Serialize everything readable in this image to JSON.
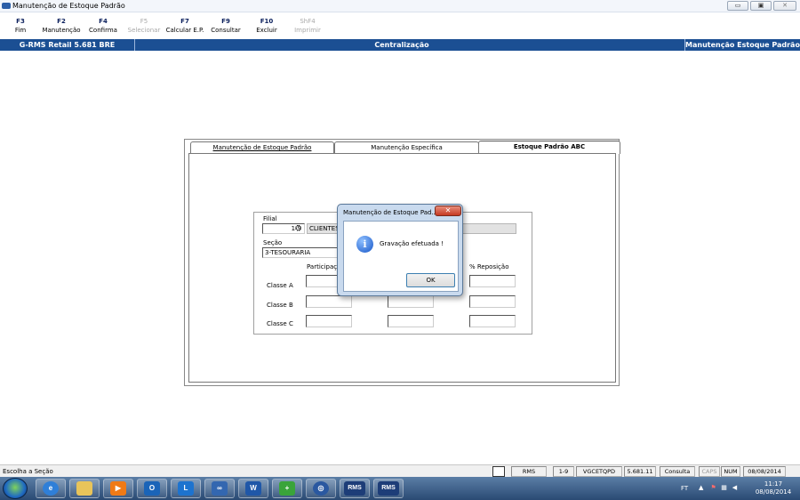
{
  "window": {
    "title": "Manutenção de Estoque Padrão",
    "controls": [
      "▭",
      "▣",
      "✕"
    ]
  },
  "toolbar": [
    {
      "key": "F3",
      "label": "Fim",
      "enabled": true
    },
    {
      "key": "F2",
      "label": "Manutenção",
      "enabled": true
    },
    {
      "key": "F4",
      "label": "Confirma",
      "enabled": true
    },
    {
      "key": "F5",
      "label": "Selecionar",
      "enabled": false
    },
    {
      "key": "F7",
      "label": "Calcular E.P.",
      "enabled": true
    },
    {
      "key": "F9",
      "label": "Consultar",
      "enabled": true
    },
    {
      "key": "F10",
      "label": "Excluir",
      "enabled": true
    },
    {
      "key": "ShF4",
      "label": "Imprimir",
      "enabled": false
    }
  ],
  "header": {
    "left": "G-RMS Retail 5.681 BRE",
    "center": "Centralização",
    "right": "Manutenção Estoque Padrão"
  },
  "tabs": [
    {
      "label": "Manutenção de Estoque Padrão",
      "active": false
    },
    {
      "label": "Manutenção Específica",
      "active": false
    },
    {
      "label": "Estoque Padrão ABC",
      "active": true
    }
  ],
  "form": {
    "filial_label": "Filial",
    "filial_value": "1-9",
    "filial_name": "CLIENTES_",
    "secao_label": "Seção",
    "secao_value": "3-TESOURARIA",
    "col_participacao": "Participação",
    "col_reposicao": "% Reposição",
    "classes": [
      "Classe A",
      "Classe B",
      "Classe C"
    ]
  },
  "dialog": {
    "title": "Manutenção de Estoque Pad...",
    "close": "✕",
    "message": "Gravação efetuada !",
    "ok": "OK",
    "icon": "i"
  },
  "statusbar": {
    "message": "Escolha a Seção",
    "cells": [
      "RMS",
      "1-9",
      "VGCETQPD",
      "5.681.11",
      "Consulta",
      "CAPS",
      "NUM",
      "08/08/2014"
    ]
  },
  "taskbar": {
    "apps": [
      "ie-icon",
      "explorer-icon",
      "media-player-icon",
      "outlook-icon",
      "lync-icon",
      "pairing-icon",
      "word-icon",
      "app-icon",
      "browser-icon",
      "rms-icon",
      "rms-icon"
    ],
    "rms_label": "RMS",
    "tray_lang": "FT",
    "time": "11:17",
    "date": "08/08/2014"
  }
}
